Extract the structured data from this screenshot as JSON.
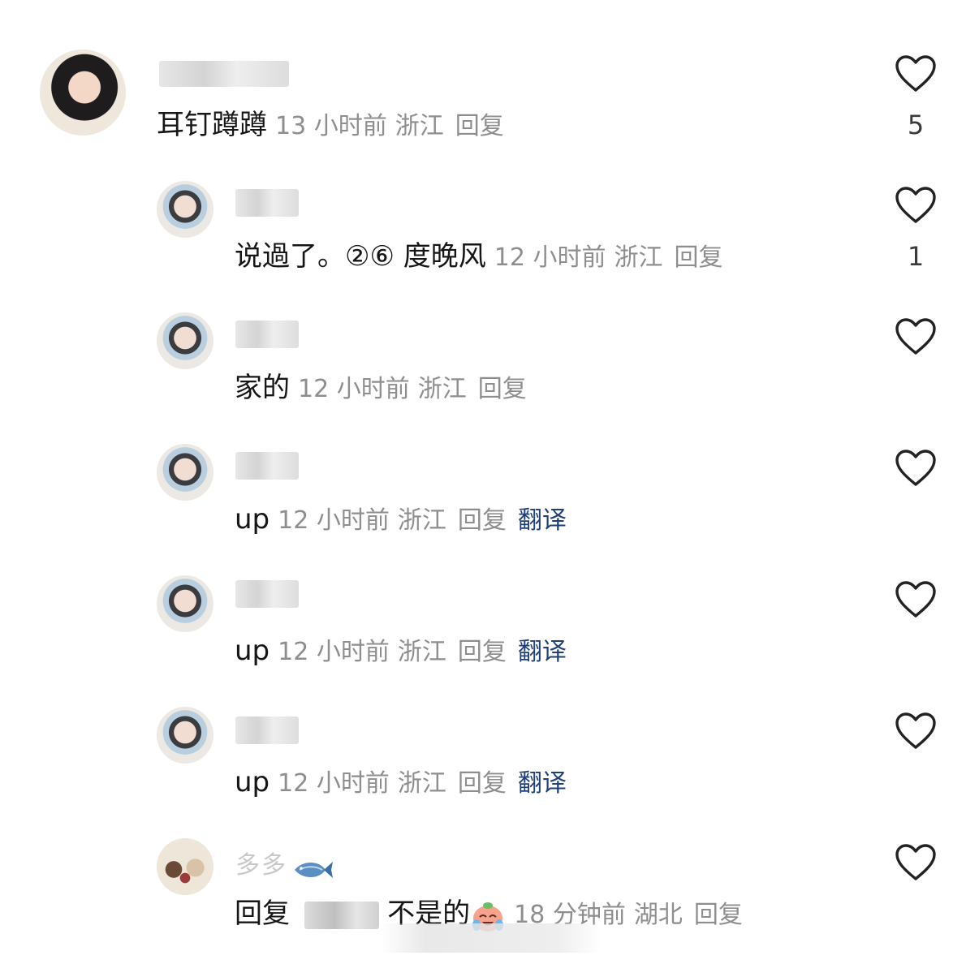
{
  "comments": [
    {
      "avatar": "profile-photo",
      "username": "",
      "content": "耳钉蹲蹲",
      "time": "13 小时前",
      "location": "浙江",
      "reply_label": "回复",
      "likes": "5"
    },
    {
      "avatar": "profile-photo",
      "username": "",
      "content": "说過了。②⑥ 度晚风",
      "time": "12 小时前",
      "location": "浙江",
      "reply_label": "回复",
      "likes": "1"
    },
    {
      "avatar": "profile-photo",
      "username": "",
      "content": "家的",
      "time": "12 小时前",
      "location": "浙江",
      "reply_label": "回复",
      "likes": ""
    },
    {
      "avatar": "profile-photo",
      "username": "",
      "content": "up",
      "time": "12 小时前",
      "location": "浙江",
      "reply_label": "回复",
      "translate_label": "翻译",
      "likes": ""
    },
    {
      "avatar": "profile-photo",
      "username": "",
      "content": "up",
      "time": "12 小时前",
      "location": "浙江",
      "reply_label": "回复",
      "translate_label": "翻译",
      "likes": ""
    },
    {
      "avatar": "profile-photo",
      "username": "",
      "content": "up",
      "time": "12 小时前",
      "location": "浙江",
      "reply_label": "回复",
      "translate_label": "翻译",
      "likes": ""
    },
    {
      "avatar": "dogs-photo",
      "username": "多多",
      "content_prefix": "回复",
      "content": "不是的",
      "time": "18 分钟前",
      "location": "湖北",
      "reply_label": "回复",
      "likes": ""
    }
  ],
  "icons": {
    "like": "heart-outline-icon",
    "emoji": "crying-laughing-emoji",
    "badge": "fish-emoji"
  },
  "colors": {
    "text": "#161616",
    "meta": "#8e8e8e",
    "translate": "#1f3f7a",
    "heart_stroke": "#222222"
  }
}
